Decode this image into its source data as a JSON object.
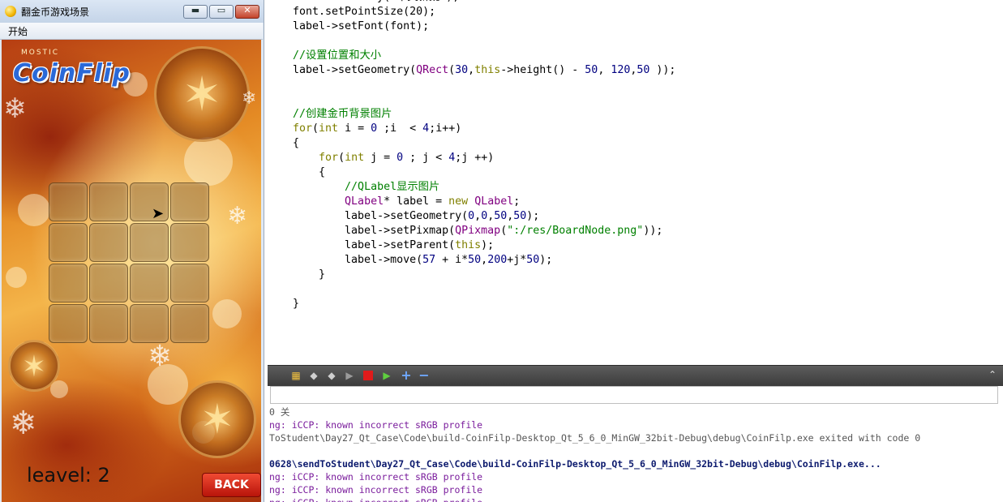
{
  "window": {
    "title": "翻金币游戏场景",
    "minimize_glyph": "▬",
    "maximize_glyph": "▭",
    "close_glyph": "✕",
    "menu": [
      "开始"
    ]
  },
  "game": {
    "logo_small": "MOSTIC",
    "logo": "CoinFlip",
    "level_label": "leavel: 2",
    "back_label": "BACK"
  },
  "code_lines": [
    [
      [
        "font.setFamily(\"华文新魏\");",
        ""
      ]
    ],
    [
      [
        "font.setPointSize(20);",
        ""
      ]
    ],
    [
      [
        "label->setFont(font);",
        ""
      ]
    ],
    [
      [
        "",
        ""
      ]
    ],
    [
      [
        "//设置位置和大小",
        "comment"
      ]
    ],
    [
      [
        "label->setGeometry(",
        ""
      ],
      [
        "QRect",
        "type"
      ],
      [
        "(",
        ""
      ],
      [
        "30",
        "num"
      ],
      [
        ",",
        ""
      ],
      [
        "this",
        "this"
      ],
      [
        "->height() - ",
        ""
      ],
      [
        "50",
        "num"
      ],
      [
        ", ",
        ""
      ],
      [
        "120",
        "num"
      ],
      [
        ",",
        ""
      ],
      [
        "50",
        "num"
      ],
      [
        " ));",
        ""
      ]
    ],
    [
      [
        "",
        ""
      ]
    ],
    [
      [
        "",
        ""
      ]
    ],
    [
      [
        "//创建金币背景图片",
        "comment"
      ]
    ],
    [
      [
        "for",
        "kw"
      ],
      [
        "(",
        ""
      ],
      [
        "int",
        "kw"
      ],
      [
        " i = ",
        ""
      ],
      [
        "0",
        "num"
      ],
      [
        " ;i  < ",
        ""
      ],
      [
        "4",
        "num"
      ],
      [
        ";i++)",
        ""
      ]
    ],
    [
      [
        "{",
        ""
      ]
    ],
    [
      [
        "    ",
        ""
      ],
      [
        "for",
        "kw"
      ],
      [
        "(",
        ""
      ],
      [
        "int",
        "kw"
      ],
      [
        " j = ",
        ""
      ],
      [
        "0",
        "num"
      ],
      [
        " ; j < ",
        ""
      ],
      [
        "4",
        "num"
      ],
      [
        ";j ++)",
        ""
      ]
    ],
    [
      [
        "    {",
        ""
      ]
    ],
    [
      [
        "        ",
        ""
      ],
      [
        "//QLabel显示图片",
        "comment"
      ]
    ],
    [
      [
        "        ",
        ""
      ],
      [
        "QLabel",
        "type"
      ],
      [
        "* label = ",
        ""
      ],
      [
        "new",
        "kw"
      ],
      [
        " ",
        ""
      ],
      [
        "QLabel",
        "type"
      ],
      [
        ";",
        ""
      ]
    ],
    [
      [
        "        label->setGeometry(",
        ""
      ],
      [
        "0",
        "num"
      ],
      [
        ",",
        ""
      ],
      [
        "0",
        "num"
      ],
      [
        ",",
        ""
      ],
      [
        "50",
        "num"
      ],
      [
        ",",
        ""
      ],
      [
        "50",
        "num"
      ],
      [
        ");",
        ""
      ]
    ],
    [
      [
        "        label->setPixmap(",
        ""
      ],
      [
        "QPixmap",
        "type"
      ],
      [
        "(",
        ""
      ],
      [
        "\":/res/BoardNode.png\"",
        "str"
      ],
      [
        "));",
        ""
      ]
    ],
    [
      [
        "        label->setParent(",
        ""
      ],
      [
        "this",
        "this"
      ],
      [
        ");",
        ""
      ]
    ],
    [
      [
        "        label->move(",
        ""
      ],
      [
        "57",
        "num"
      ],
      [
        " + i*",
        ""
      ],
      [
        "50",
        "num"
      ],
      [
        ",",
        ""
      ],
      [
        "200",
        "num"
      ],
      [
        "+j*",
        ""
      ],
      [
        "50",
        "num"
      ],
      [
        ");",
        ""
      ]
    ],
    [
      [
        "    }",
        ""
      ]
    ],
    [
      [
        "",
        ""
      ]
    ],
    [
      [
        "}",
        ""
      ]
    ]
  ],
  "output": {
    "lines": [
      [
        "0 关",
        "gray"
      ],
      [
        "ng: iCCP: known incorrect sRGB profile",
        "purple"
      ],
      [
        "ToStudent\\Day27_Qt_Case\\Code\\build-CoinFilp-Desktop_Qt_5_6_0_MinGW_32bit-Debug\\debug\\CoinFilp.exe exited with code 0",
        "gray"
      ],
      [
        "",
        "gray"
      ],
      [
        "0628\\sendToStudent\\Day27_Qt_Case\\Code\\build-CoinFilp-Desktop_Qt_5_6_0_MinGW_32bit-Debug\\debug\\CoinFilp.exe...",
        "blue"
      ],
      [
        "ng: iCCP: known incorrect sRGB profile",
        "purple"
      ],
      [
        "ng: iCCP: known incorrect sRGB profile",
        "purple"
      ],
      [
        "ng: iCCP: known incorrect sRGB profile",
        "purple"
      ]
    ]
  },
  "colors": {
    "comment": "#008000",
    "keyword": "#808000",
    "type": "#800080",
    "back_button": "#d8281a",
    "output_toolbar": "#4a4a4a"
  },
  "icons": [
    "coin-icon",
    "minimize-icon",
    "maximize-icon",
    "close-icon",
    "build-icon",
    "prev-icon",
    "next-icon",
    "run-icon",
    "stop-icon",
    "debug-run-icon",
    "zoom-in-icon",
    "zoom-out-icon",
    "chevron-up-icon"
  ]
}
